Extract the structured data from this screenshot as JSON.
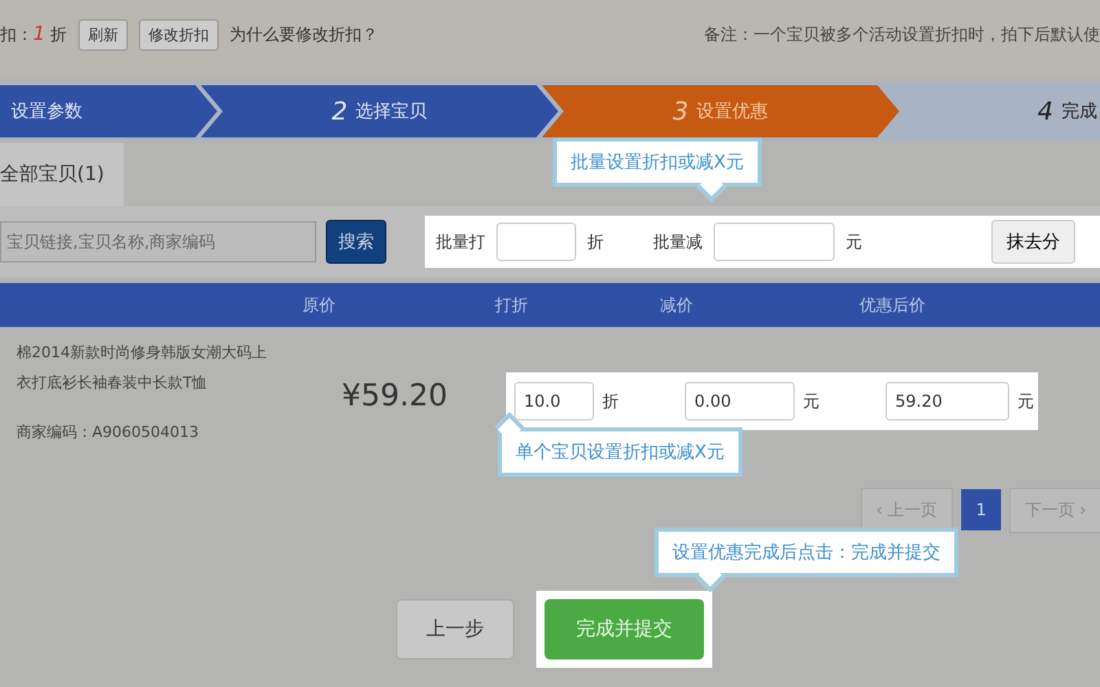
{
  "top_bar": {
    "discount_label": "扣：",
    "discount_value": "1",
    "discount_unit": "折",
    "buttons": [
      "刷新",
      "修改折扣"
    ],
    "link": "为什么要修改折扣？",
    "note": "备注：一个宝贝被多个活动设置折扣时，拍下后默认使"
  },
  "steps": [
    {
      "label": "设置参数",
      "done": true,
      "selected": false
    },
    {
      "number": "2",
      "label": "选择宝贝",
      "done": true,
      "selected": false
    },
    {
      "number": "3",
      "label": "设置优惠",
      "done": false,
      "selected": true
    },
    {
      "number": "4",
      "label": "完成",
      "done": false,
      "selected": false
    }
  ],
  "tabs": [
    {
      "label": "全部宝贝(1)",
      "selected": true
    }
  ],
  "search": {
    "placeholder": "宝贝链接,宝贝名称,商家编码",
    "button": "搜索"
  },
  "batch": {
    "discount_label": "批量打",
    "discount_unit": "折",
    "reduce_label": "批量减",
    "reduce_unit": "元",
    "button": "抹去分"
  },
  "table": {
    "columns": [
      "原价",
      "打折",
      "减价",
      "优惠后价"
    ],
    "rows": [
      {
        "title": "棉2014新款时尚修身韩版女潮大码上衣打底衫长袖春装中长款T恤",
        "code": "商家编码：A9060504013",
        "price": "¥59.20",
        "discount": "10.0",
        "discount_unit": "折",
        "reduce": "0.00",
        "reduce_unit": "元",
        "final": "59.20",
        "final_unit": "元"
      }
    ]
  },
  "pagination": {
    "prev": "‹ 上一页",
    "pages": [
      {
        "label": "1",
        "selected": true
      }
    ],
    "next": "下一页 ›"
  },
  "actions": {
    "back": "上一步",
    "submit": "完成并提交"
  },
  "tips": [
    "批量设置折扣或减X元",
    "单个宝贝设置折扣或减X元",
    "设置优惠完成后点击：完成并提交"
  ]
}
